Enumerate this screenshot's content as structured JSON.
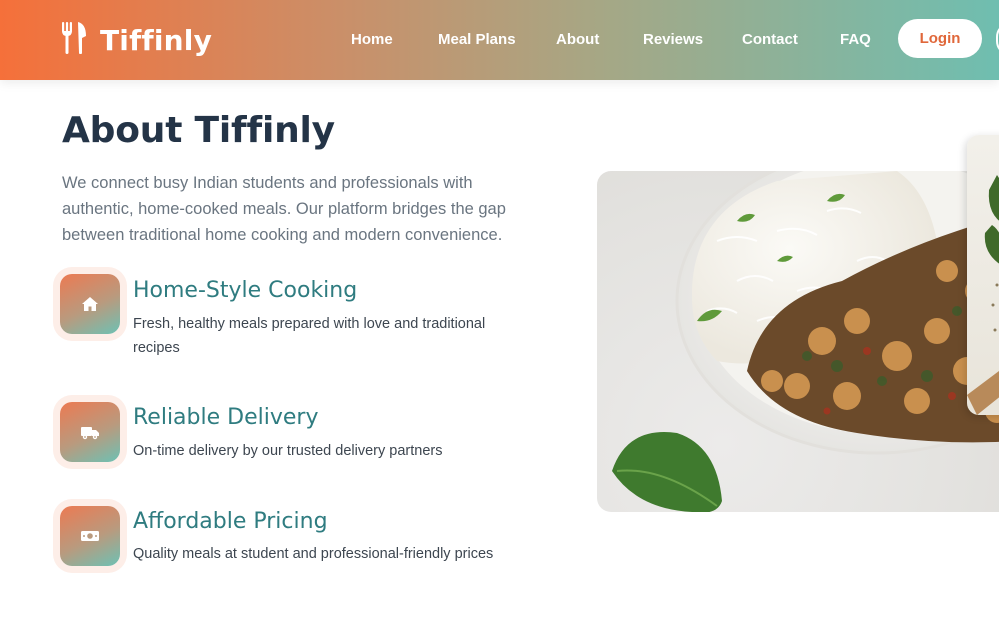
{
  "brand": {
    "name": "Tiffinly",
    "icon": "utensils-icon"
  },
  "nav": {
    "items": [
      {
        "label": "Home"
      },
      {
        "label": "Meal Plans"
      },
      {
        "label": "About"
      },
      {
        "label": "Reviews"
      },
      {
        "label": "Contact"
      },
      {
        "label": "FAQ"
      }
    ],
    "login_label": "Login"
  },
  "about": {
    "title": "About Tiffinly",
    "intro": "We connect busy Indian students and professionals with authentic, home-cooked meals. Our platform bridges the gap between traditional home cooking and modern convenience.",
    "features": [
      {
        "icon": "home-icon",
        "title": "Home-Style Cooking",
        "description": "Fresh, healthy meals prepared with love and traditional recipes"
      },
      {
        "icon": "truck-icon",
        "title": "Reliable Delivery",
        "description": "On-time delivery by our trusted delivery partners"
      },
      {
        "icon": "money-bill-icon",
        "title": "Affordable Pricing",
        "description": "Quality meals at student and professional-friendly prices"
      }
    ]
  },
  "colors": {
    "accent_orange": "#f5703a",
    "accent_teal": "#6fbeb0",
    "heading_dark": "#243447",
    "feature_title": "#2f7c80"
  }
}
